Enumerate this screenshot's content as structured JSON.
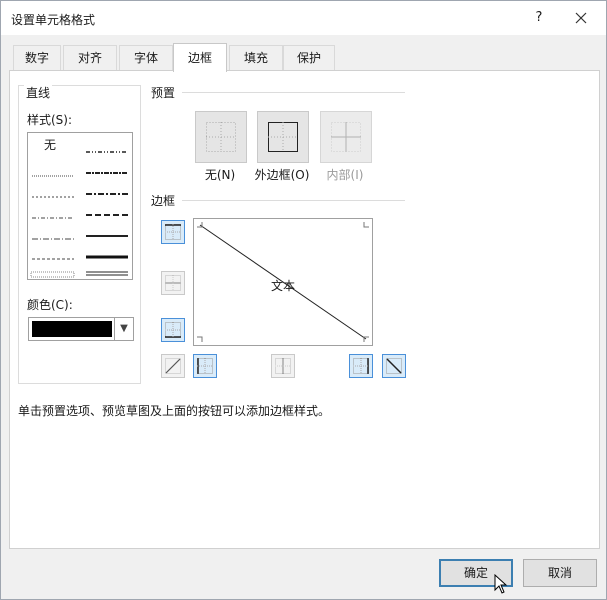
{
  "window": {
    "title": "设置单元格格式",
    "help": "?",
    "close": "✕"
  },
  "tabs": [
    {
      "label": "数字"
    },
    {
      "label": "对齐"
    },
    {
      "label": "字体"
    },
    {
      "label": "边框",
      "active": true
    },
    {
      "label": "填充"
    },
    {
      "label": "保护"
    }
  ],
  "line": {
    "group_label": "直线",
    "style_label": "样式(S):",
    "none_label": "无",
    "color_label": "颜色(C):",
    "color_value": "#000000"
  },
  "presets": {
    "group_label": "预置",
    "items": [
      {
        "label": "无(N)",
        "enabled": true
      },
      {
        "label": "外边框(O)",
        "enabled": true
      },
      {
        "label": "内部(I)",
        "enabled": false
      }
    ]
  },
  "border": {
    "group_label": "边框",
    "preview_text": "文本"
  },
  "hint_text": "单击预置选项、预览草图及上面的按钮可以添加边框样式。",
  "buttons": {
    "ok": "确定",
    "cancel": "取消"
  },
  "colors": {
    "accent": "#4a90d9",
    "selected_bg": "#d9ebf9",
    "disabled_text": "#9a9a9a"
  }
}
